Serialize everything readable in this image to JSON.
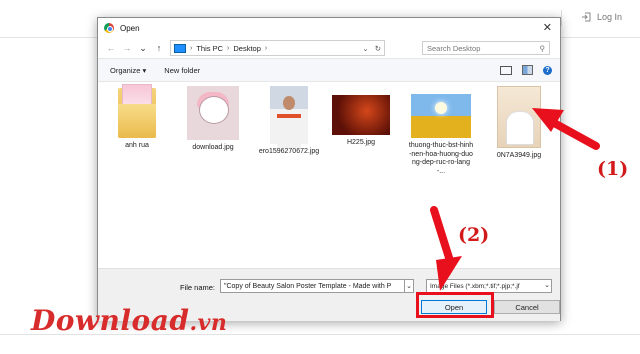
{
  "background": {
    "login_label": "Log In"
  },
  "dialog": {
    "title": "Open",
    "breadcrumb": [
      "This PC",
      "Desktop"
    ],
    "search_placeholder": "Search Desktop",
    "toolbar": {
      "organize": "Organize",
      "new_folder": "New folder"
    },
    "files": [
      {
        "name": "anh rua",
        "kind": "folder"
      },
      {
        "name": "download.jpg",
        "kind": "image"
      },
      {
        "name": "ero1596270672.jpg",
        "kind": "image"
      },
      {
        "name": "H225.jpg",
        "kind": "image"
      },
      {
        "name": "thuong-thuc-bst-hinh-nen-hoa-huong-duong-dep-ruc-ro-lang-...",
        "kind": "image"
      },
      {
        "name": "0N7A3949.jpg",
        "kind": "image"
      }
    ],
    "file_name_label": "File name:",
    "file_name_value": "\"Copy of Beauty Salon Poster Template - Made with P",
    "file_type_value": "Image Files (*.xbm;*.tif;*.pjp;*.jf",
    "open_label": "Open",
    "cancel_label": "Cancel"
  },
  "annotations": {
    "step1": "(1)",
    "step2": "(2)"
  },
  "watermark": {
    "main": "Download",
    "tld": ".vn"
  },
  "colors": {
    "annotation_red": "#e8101c",
    "dialog_border": "#8a8a8a",
    "open_button_border": "#0078d7"
  }
}
